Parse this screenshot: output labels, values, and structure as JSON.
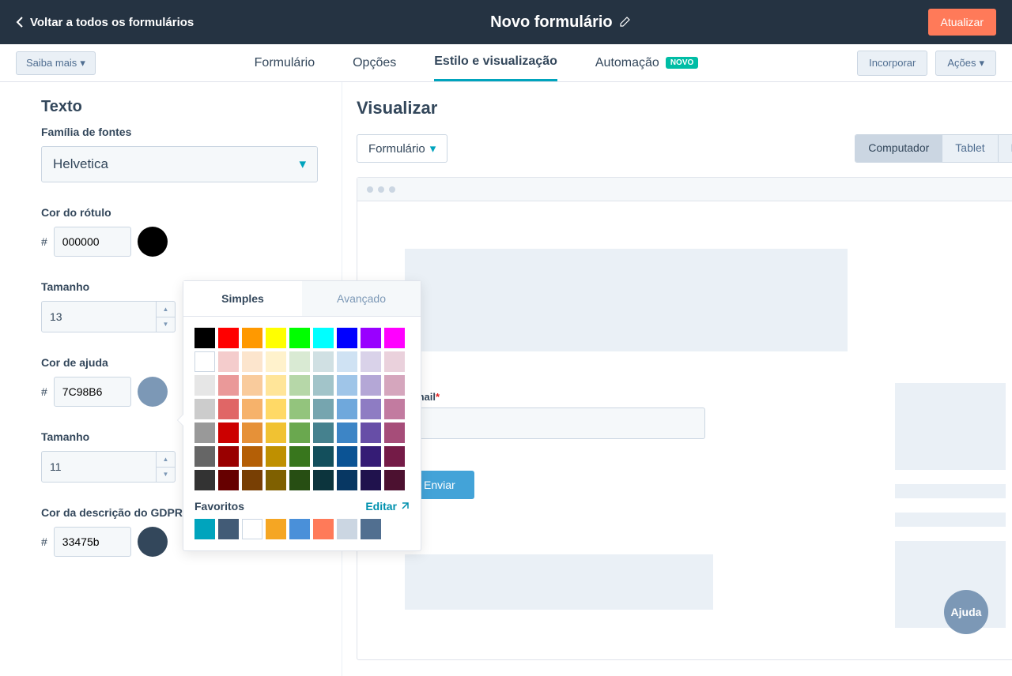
{
  "topbar": {
    "back": "Voltar a todos os formulários",
    "title": "Novo formulário",
    "update": "Atualizar"
  },
  "subnav": {
    "learn_more": "Saiba mais",
    "tabs": [
      "Formulário",
      "Opções",
      "Estilo e visualização",
      "Automação"
    ],
    "novo": "NOVO",
    "embed": "Incorporar",
    "actions": "Ações"
  },
  "sidebar": {
    "heading": "Texto",
    "font_family_label": "Família de fontes",
    "font_family": "Helvetica",
    "label_color_label": "Cor do rótulo",
    "label_color": "000000",
    "label_color_hex": "#000000",
    "size1_label": "Tamanho",
    "size1": "13",
    "help_color_label": "Cor de ajuda",
    "help_color": "7C98B6",
    "help_color_hex": "#7c98b6",
    "size2_label": "Tamanho",
    "size2": "11",
    "gdpr_color_label": "Cor da descrição do GDPR",
    "gdpr_color": "33475b",
    "gdpr_color_hex": "#33475b"
  },
  "picker": {
    "tab_simple": "Simples",
    "tab_advanced": "Avançado",
    "favorites": "Favoritos",
    "edit": "Editar",
    "colors": [
      "#000000",
      "#ff0000",
      "#ff9900",
      "#ffff00",
      "#00ff00",
      "#00ffff",
      "#0000ff",
      "#9900ff",
      "#ff00ff",
      "#ffffff",
      "#f4cccc",
      "#fce5cd",
      "#fff2cc",
      "#d9ead3",
      "#d0e0e3",
      "#cfe2f3",
      "#d9d2e9",
      "#ead1dc",
      "#e6e6e6",
      "#ea9999",
      "#f9cb9c",
      "#ffe599",
      "#b6d7a8",
      "#a2c4c9",
      "#9fc5e8",
      "#b4a7d6",
      "#d5a6bd",
      "#cccccc",
      "#e06666",
      "#f6b26b",
      "#ffd966",
      "#93c47d",
      "#76a5af",
      "#6fa8dc",
      "#8e7cc3",
      "#c27ba0",
      "#999999",
      "#cc0000",
      "#e69138",
      "#f1c232",
      "#6aa84f",
      "#45818e",
      "#3d85c6",
      "#674ea7",
      "#a64d79",
      "#666666",
      "#990000",
      "#b45f06",
      "#bf9000",
      "#38761d",
      "#134f5c",
      "#0b5394",
      "#351c75",
      "#741b47",
      "#333333",
      "#660000",
      "#783f04",
      "#7f6000",
      "#274e13",
      "#0c343d",
      "#073763",
      "#20124d",
      "#4c1130"
    ],
    "favorite_colors": [
      "#00a4bd",
      "#425b76",
      "#ffffff",
      "#f5a623",
      "#4a90d9",
      "#ff7a59",
      "#cbd6e2",
      "#516f90"
    ]
  },
  "preview": {
    "heading": "Visualizar",
    "dropdown": "Formulário",
    "devices": [
      "Computador",
      "Tablet",
      "Móvel"
    ],
    "email_label": "E-mail",
    "submit": "Enviar"
  },
  "help": "Ajuda"
}
